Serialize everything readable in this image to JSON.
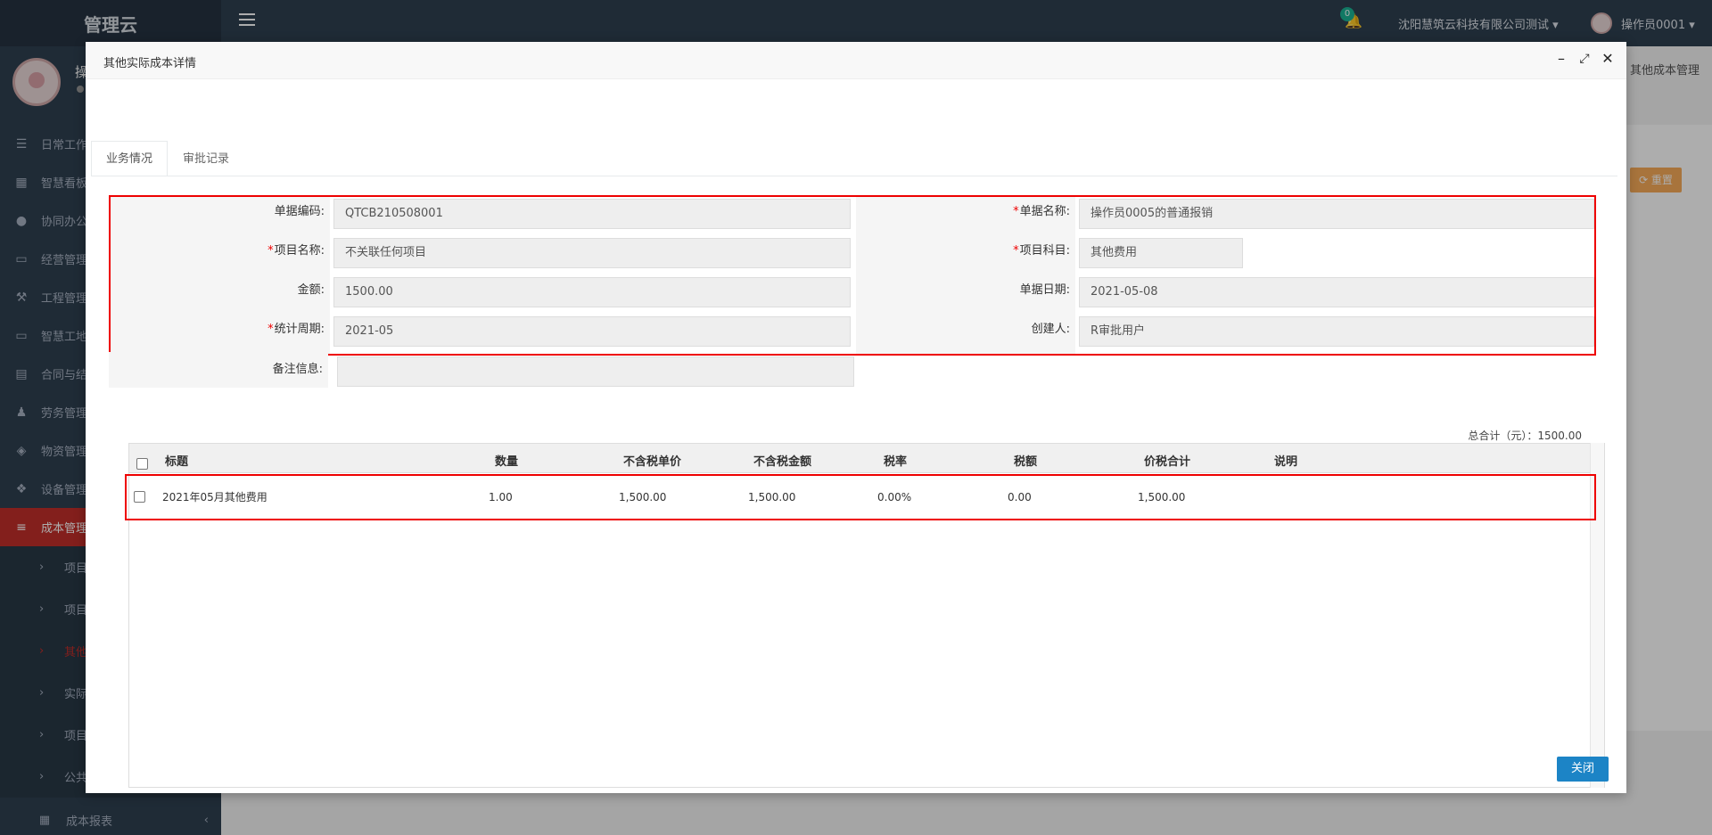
{
  "app": {
    "brand": "管理云"
  },
  "topbar": {
    "notification_count": "0",
    "company": "沈阳慧筑云科技有限公司测试",
    "user": "操作员0001"
  },
  "profile": {
    "name": "操"
  },
  "sidebar": {
    "items": [
      {
        "label": "日常工作",
        "icon": "indent-icon"
      },
      {
        "label": "智慧看板",
        "icon": "dashboard-icon"
      },
      {
        "label": "协同办公",
        "icon": "users-icon"
      },
      {
        "label": "经营管理",
        "icon": "monitor-icon"
      },
      {
        "label": "工程管理",
        "icon": "gavel-icon"
      },
      {
        "label": "智慧工地",
        "icon": "monitor-icon"
      },
      {
        "label": "合同与结",
        "icon": "file-icon"
      },
      {
        "label": "劳务管理",
        "icon": "worker-icon"
      },
      {
        "label": "物资管理",
        "icon": "cube-icon"
      },
      {
        "label": "设备管理",
        "icon": "cubes-icon"
      },
      {
        "label": "成本管理",
        "icon": "list-icon"
      }
    ],
    "sub_items": [
      {
        "label": "项目"
      },
      {
        "label": "项目"
      },
      {
        "label": "其他"
      },
      {
        "label": "实际"
      },
      {
        "label": "项目"
      },
      {
        "label": "公共"
      }
    ],
    "bottom": {
      "label": "成本报表"
    }
  },
  "background": {
    "breadcrumb": "其他成本管理",
    "reset_label": "⟳ 重置"
  },
  "modal": {
    "title": "其他实际成本详情",
    "tabs": [
      {
        "label": "业务情况"
      },
      {
        "label": "审批记录"
      }
    ],
    "fields": {
      "code": {
        "label": "单据编码:",
        "value": "QTCB210508001"
      },
      "name": {
        "label": "单据名称:",
        "value": "操作员0005的普通报销"
      },
      "project": {
        "label": "项目名称:",
        "value": "不关联任何项目"
      },
      "subject": {
        "label": "项目科目:",
        "value": "其他费用"
      },
      "amount": {
        "label": "金额:",
        "value": "1500.00"
      },
      "date": {
        "label": "单据日期:",
        "value": "2021-05-08"
      },
      "period": {
        "label": "统计周期:",
        "value": "2021-05"
      },
      "creator": {
        "label": "创建人:",
        "value": "R审批用户"
      },
      "remark": {
        "label": "备注信息:",
        "value": ""
      }
    },
    "total": "总合计（元）：1500.00",
    "table": {
      "columns": [
        "标题",
        "数量",
        "不含税单价",
        "不含税金额",
        "税率",
        "税额",
        "价税合计",
        "说明"
      ],
      "rows": [
        {
          "title": "2021年05月其他费用",
          "qty": "1.00",
          "unit_price": "1,500.00",
          "amount": "1,500.00",
          "tax_rate": "0.00%",
          "tax": "0.00",
          "total": "1,500.00",
          "note": ""
        }
      ]
    },
    "close_label": "关闭"
  }
}
